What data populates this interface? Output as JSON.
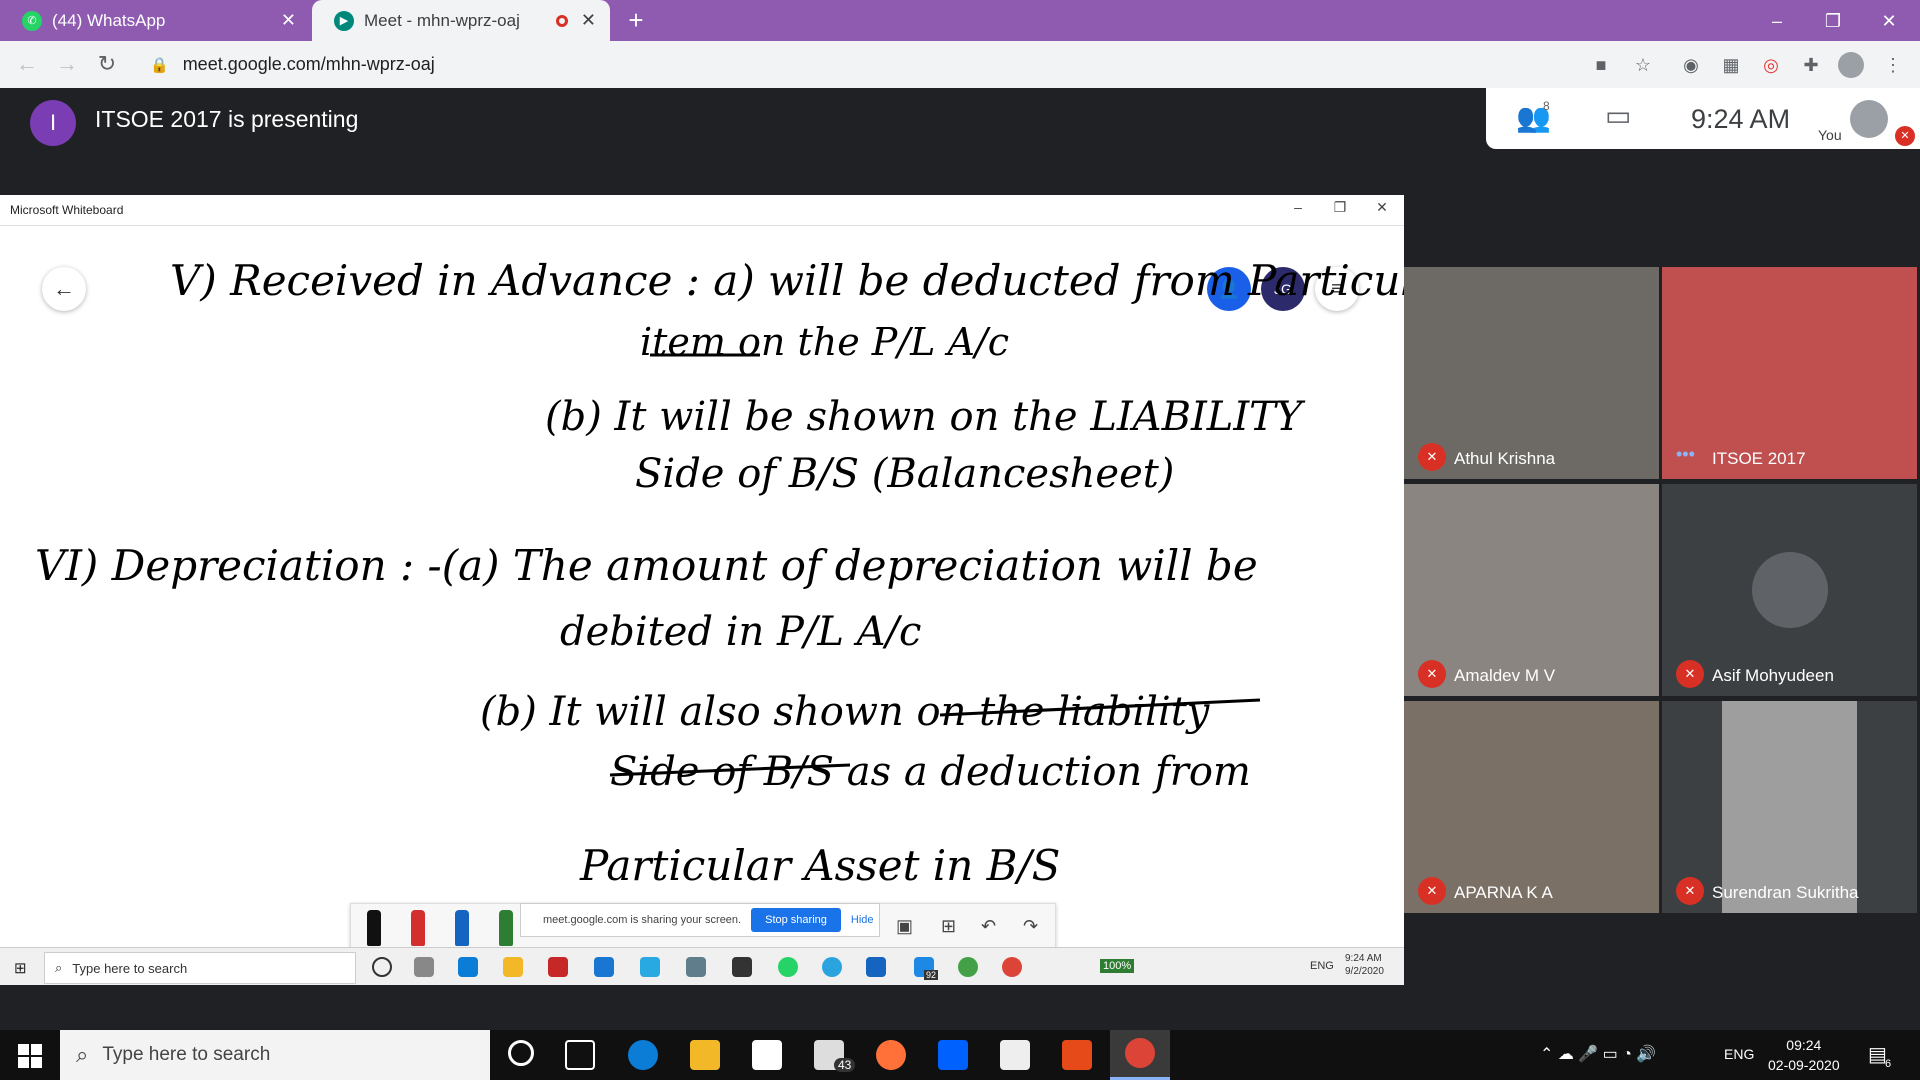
{
  "browser": {
    "tabs": [
      {
        "label": "(44) WhatsApp",
        "icon": "whatsapp-icon",
        "active": false
      },
      {
        "label": "Meet - mhn-wprz-oaj",
        "icon": "meet-icon",
        "active": true
      }
    ],
    "url": "meet.google.com/mhn-wprz-oaj"
  },
  "meet": {
    "presenter_initial": "I",
    "presenting_title": "ITSOE 2017 is presenting",
    "people_count": "8",
    "time": "9:24 AM",
    "you_label": "You",
    "participants": [
      {
        "name": "Athul Krishna",
        "muted": true
      },
      {
        "name": "ITSOE 2017",
        "muted": false
      },
      {
        "name": "Amaldev M V",
        "muted": true
      },
      {
        "name": "Asif Mohyudeen",
        "muted": true
      },
      {
        "name": "APARNA K A",
        "muted": true
      },
      {
        "name": "Surendran Sukritha",
        "muted": true
      }
    ]
  },
  "whiteboard": {
    "window_title": "Microsoft Whiteboard",
    "user_initials": "JG",
    "ink_lines": [
      "V) Received in Advance : a) will be deducted from Particulars",
      "item on the P/L A/c",
      "(b) It will be shown on the LIABILITY",
      "Side of B/S (Balancesheet)",
      "VI) Depreciation : -(a) The amount of depreciation will be",
      "debited in P/L A/c",
      "(b) It will also shown on the liability",
      "Side of B/S as a deduction from",
      "Particular Asset in B/S"
    ],
    "share_banner": "meet.google.com is sharing your screen.",
    "stop_sharing_label": "Stop sharing",
    "hide_label": "Hide"
  },
  "inner_taskbar": {
    "search_placeholder": "Type here to search",
    "battery": "100%",
    "lang": "ENG",
    "time": "9:24 AM",
    "date": "9/2/2020",
    "mail_badge": "92"
  },
  "taskbar": {
    "search_placeholder": "Type here to search",
    "mail_badge": "43",
    "lang": "ENG",
    "time": "09:24",
    "date": "02-09-2020",
    "notification_count": "6"
  }
}
